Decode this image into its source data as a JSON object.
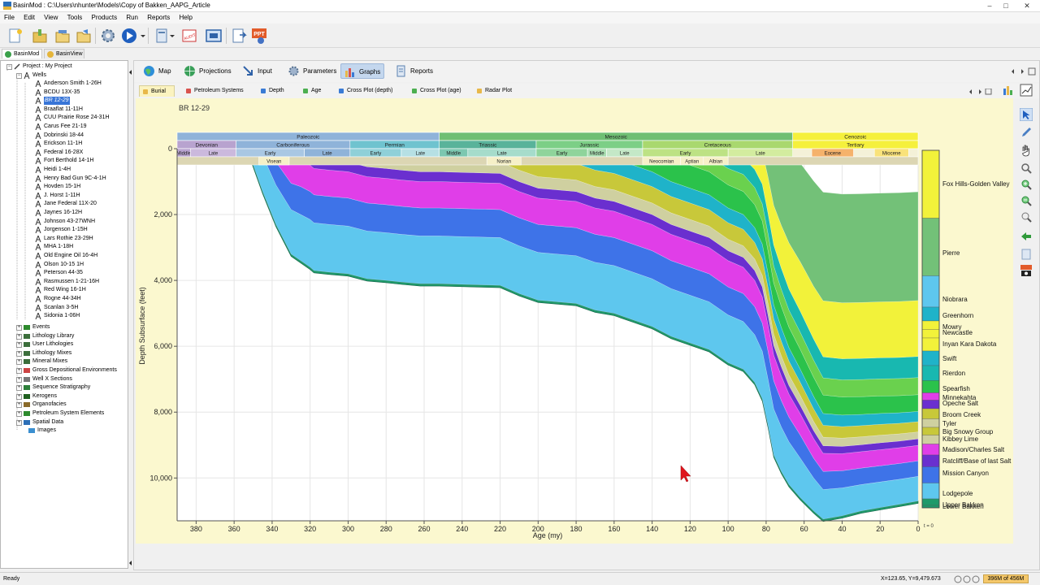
{
  "window": {
    "title": "BasinMod : C:\\Users\\nhunter\\Models\\Copy of Bakken_AAPG_Article",
    "controls": [
      "–",
      "□",
      "✕"
    ]
  },
  "menu": [
    "File",
    "Edit",
    "View",
    "Tools",
    "Products",
    "Run",
    "Reports",
    "Help"
  ],
  "toolbar": {
    "icons": [
      "new-document-icon",
      "open-folder-icon",
      "open-icon",
      "save-icon",
      "settings-gear-icon",
      "run-play-icon",
      "documents-icon",
      "audit-icon",
      "fit-window-icon",
      "export-icon",
      "ppt-export-icon"
    ],
    "audit_label": "AUDIT",
    "ppt_label": "PPT"
  },
  "view_tabs": [
    {
      "label": "BasinMod",
      "active": true
    },
    {
      "label": "BasinView",
      "active": false
    }
  ],
  "tree": {
    "project": "Project : My Project",
    "wells_label": "Wells",
    "wells": [
      "Anderson Smith 1-26H",
      "BCDU 13X-35",
      "BR 12-29",
      "Braaflat 11-11H",
      "CUU Prairie Rose 24-31H",
      "Carus Fee 21-19",
      "Dobrinski 18-44",
      "Erickson 11-1H",
      "Federal 16-28X",
      "Fort Berthold 14-1H",
      "Heidi 1-4H",
      "Henry Bad Gun 9C-4-1H",
      "Hovden 15-1H",
      "J. Horst 1-11H",
      "Jane Federal 11X-20",
      "Jaynes 16-12H",
      "Johnson 43-27WNH",
      "Jorgenson 1-15H",
      "Lars Rothie 23-29H",
      "MHA 1-18H",
      "Old Engine Oil 16-4H",
      "Olson 10-15 1H",
      "Peterson 44-35",
      "Rasmussen 1-21-16H",
      "Red Wing 16-1H",
      "Rogne 44-34H",
      "Scanlan 3-5H",
      "Sidonia 1-06H"
    ],
    "selected_well": "BR 12-29",
    "groups": [
      "Events",
      "Lithology Library",
      "User Lithologies",
      "Lithology Mixes",
      "Mineral Mixes",
      "Gross Depositional Environments",
      "Well X Sections",
      "Sequence Stratigraphy",
      "Kerogens",
      "Organofacies",
      "Petroleum System Elements",
      "Spatial Data",
      "Images"
    ]
  },
  "top_tabs": [
    {
      "label": "Map",
      "active": false
    },
    {
      "label": "Projections",
      "active": false
    },
    {
      "label": "Input",
      "active": false
    },
    {
      "label": "Parameters",
      "active": false
    },
    {
      "label": "Graphs",
      "active": true
    },
    {
      "label": "Reports",
      "active": false
    }
  ],
  "sub_tabs": [
    {
      "label": "Burial",
      "color": "#e8b84a",
      "active": true
    },
    {
      "label": "Petroleum Systems",
      "color": "#d9534f",
      "active": false
    },
    {
      "label": "Depth",
      "color": "#3a7bd5",
      "active": false
    },
    {
      "label": "Age",
      "color": "#4caf50",
      "active": false
    },
    {
      "label": "Cross Plot (depth)",
      "color": "#3a7bd5",
      "active": false
    },
    {
      "label": "Cross Plot (age)",
      "color": "#4caf50",
      "active": false
    },
    {
      "label": "Radar Plot",
      "color": "#e8b84a",
      "active": false
    }
  ],
  "chart_data": {
    "type": "area",
    "title": "BR 12-29",
    "xlabel": "Age (my)",
    "ylabel": "Depth Subsurface (feet)",
    "xlim": [
      390,
      0
    ],
    "ylim": [
      0,
      11300
    ],
    "x_ticks": [
      380,
      360,
      340,
      320,
      300,
      280,
      260,
      240,
      220,
      200,
      180,
      160,
      140,
      120,
      100,
      80,
      60,
      40,
      20,
      0
    ],
    "y_ticks": [
      0,
      2000,
      4000,
      6000,
      8000,
      10000
    ],
    "y_tick_labels": [
      "0",
      "2,000",
      "4,000",
      "6,000",
      "8,000",
      "10,000"
    ],
    "grid": true,
    "eras": [
      {
        "name": "Paleozoic",
        "from": 390,
        "to": 252,
        "color": "#8fb3d9"
      },
      {
        "name": "Mesozoic",
        "from": 252,
        "to": 66,
        "color": "#6fbf73"
      },
      {
        "name": "Cenozoic",
        "from": 66,
        "to": 0,
        "color": "#f5f03c"
      }
    ],
    "periods": [
      {
        "name": "Devonian",
        "from": 390,
        "to": 359,
        "color": "#b8a3cf"
      },
      {
        "name": "Carboniferous",
        "from": 359,
        "to": 299,
        "color": "#8fb3d9"
      },
      {
        "name": "Permian",
        "from": 299,
        "to": 252,
        "color": "#6fc3cf"
      },
      {
        "name": "Triassic",
        "from": 252,
        "to": 201,
        "color": "#59b39a"
      },
      {
        "name": "Jurassic",
        "from": 201,
        "to": 145,
        "color": "#7ccf86"
      },
      {
        "name": "Cretaceous",
        "from": 145,
        "to": 66,
        "color": "#a9d86e"
      },
      {
        "name": "Tertiary",
        "from": 66,
        "to": 0,
        "color": "#f5f03c"
      }
    ],
    "epochs": [
      {
        "name": "Middle",
        "from": 390,
        "to": 383,
        "color": "#b8a3cf"
      },
      {
        "name": "Late",
        "from": 383,
        "to": 359,
        "color": "#cbb9dd"
      },
      {
        "name": "Early",
        "from": 359,
        "to": 323,
        "color": "#a9c7e3"
      },
      {
        "name": "Late",
        "from": 323,
        "to": 299,
        "color": "#8fb3d9"
      },
      {
        "name": "Early",
        "from": 299,
        "to": 272,
        "color": "#8fd0d8"
      },
      {
        "name": "Late",
        "from": 272,
        "to": 252,
        "color": "#b6e0e4"
      },
      {
        "name": "Middle",
        "from": 252,
        "to": 237,
        "color": "#7cc7b0"
      },
      {
        "name": "Late",
        "from": 237,
        "to": 201,
        "color": "#a6dccb"
      },
      {
        "name": "Early",
        "from": 201,
        "to": 174,
        "color": "#8fd49b"
      },
      {
        "name": "Middle",
        "from": 174,
        "to": 164,
        "color": "#a8ddb1"
      },
      {
        "name": "Late",
        "from": 164,
        "to": 145,
        "color": "#c4e8c7"
      },
      {
        "name": "Early",
        "from": 145,
        "to": 100,
        "color": "#bde284"
      },
      {
        "name": "Late",
        "from": 100,
        "to": 66,
        "color": "#d3ec9f"
      },
      {
        "name": "Eocene",
        "from": 56,
        "to": 34,
        "color": "#f5b26b"
      },
      {
        "name": "Miocene",
        "from": 23,
        "to": 5,
        "color": "#f9e27a"
      }
    ],
    "stages": [
      {
        "name": "Visean",
        "from": 347,
        "to": 331
      },
      {
        "name": "Norian",
        "from": 227,
        "to": 209
      },
      {
        "name": "Neocomian",
        "from": 145,
        "to": 125
      },
      {
        "name": "Aptian",
        "from": 125,
        "to": 113
      },
      {
        "name": "Albian",
        "from": 113,
        "to": 100
      }
    ],
    "basement": {
      "ages": [
        390,
        353,
        345,
        338,
        330,
        325,
        320,
        318,
        310,
        300,
        290,
        280,
        272,
        262,
        252,
        240,
        220,
        210,
        200,
        190,
        180,
        170,
        160,
        150,
        140,
        130,
        120,
        110,
        100,
        92,
        86,
        82,
        79,
        76,
        72,
        68,
        62,
        55,
        50,
        40,
        30,
        20,
        10,
        0
      ],
      "depths": [
        0,
        0,
        1300,
        2300,
        3200,
        3400,
        3600,
        3700,
        3750,
        3800,
        3950,
        4000,
        4050,
        4100,
        4100,
        4120,
        4150,
        4400,
        4600,
        4650,
        4700,
        4900,
        5000,
        5200,
        5400,
        5700,
        5900,
        6100,
        6500,
        6700,
        7100,
        7600,
        8400,
        9300,
        9800,
        10200,
        10600,
        11000,
        11250,
        11150,
        11000,
        10900,
        10800,
        10700
      ]
    },
    "layers": [
      {
        "color": "#5ec7ee",
        "base_age": 353,
        "thickness": [
          0,
          0,
          1100,
          1200,
          1350,
          1400,
          1450,
          1450,
          1450,
          1450,
          1450,
          1450,
          1450,
          1450,
          1450,
          1450,
          1450,
          1450,
          1450,
          1450,
          1450,
          1450,
          1450,
          1450,
          1450,
          1450,
          1450,
          1450,
          1450,
          1450,
          1450,
          1450,
          1400,
          1400,
          1350,
          1300,
          1200,
          1000,
          900,
          850,
          800,
          780,
          760,
          750
        ]
      },
      {
        "color": "#3e73e8",
        "base_age": 345,
        "thickness": [
          0,
          0,
          0,
          700,
          800,
          850,
          850,
          850,
          850,
          850,
          850,
          850,
          850,
          850,
          850,
          850,
          850,
          850,
          850,
          850,
          850,
          850,
          850,
          850,
          850,
          850,
          850,
          850,
          850,
          850,
          850,
          850,
          850,
          850,
          800,
          750,
          700,
          600,
          550,
          520,
          500,
          490,
          480,
          470
        ]
      },
      {
        "color": "#e03ee8",
        "base_age": 330,
        "thickness": [
          0,
          0,
          0,
          0,
          700,
          800,
          800,
          800,
          800,
          800,
          800,
          800,
          800,
          800,
          800,
          800,
          800,
          800,
          800,
          800,
          800,
          800,
          800,
          800,
          800,
          800,
          800,
          800,
          800,
          800,
          800,
          800,
          800,
          780,
          750,
          700,
          650,
          600,
          550,
          520,
          500,
          490,
          480,
          470
        ]
      },
      {
        "color": "#6a2fcf",
        "base_age": 325,
        "thickness": [
          0,
          0,
          0,
          0,
          0,
          300,
          300,
          300,
          300,
          300,
          300,
          300,
          300,
          300,
          300,
          300,
          300,
          300,
          300,
          300,
          300,
          300,
          300,
          300,
          300,
          300,
          300,
          300,
          300,
          300,
          300,
          300,
          300,
          300,
          280,
          260,
          250,
          240,
          230,
          220,
          210,
          210,
          200,
          200
        ]
      },
      {
        "color": "#cfd0a0",
        "base_age": 318,
        "thickness": [
          0,
          0,
          0,
          0,
          0,
          0,
          0,
          300,
          350,
          350,
          350,
          350,
          350,
          350,
          350,
          350,
          350,
          350,
          350,
          350,
          350,
          350,
          350,
          350,
          350,
          350,
          350,
          350,
          350,
          350,
          350,
          350,
          350,
          340,
          330,
          320,
          300,
          280,
          260,
          250,
          240,
          230,
          220,
          210
        ]
      },
      {
        "color": "#c8c83a",
        "base_age": 300,
        "thickness": [
          0,
          0,
          0,
          0,
          0,
          0,
          0,
          0,
          0,
          350,
          450,
          500,
          500,
          500,
          500,
          500,
          500,
          500,
          500,
          500,
          500,
          500,
          500,
          500,
          500,
          500,
          500,
          500,
          500,
          500,
          500,
          500,
          480,
          460,
          440,
          420,
          400,
          380,
          360,
          350,
          340,
          330,
          320,
          310
        ]
      },
      {
        "color": "#1fb3c9",
        "base_age": 240,
        "thickness": [
          0,
          0,
          0,
          0,
          0,
          0,
          0,
          0,
          0,
          0,
          0,
          0,
          0,
          0,
          0,
          250,
          400,
          450,
          450,
          450,
          450,
          450,
          450,
          450,
          450,
          450,
          450,
          450,
          450,
          450,
          450,
          450,
          440,
          430,
          420,
          410,
          400,
          380,
          360,
          350,
          340,
          330,
          320,
          310
        ]
      },
      {
        "color": "#2bc24b",
        "base_age": 190,
        "thickness": [
          0,
          0,
          0,
          0,
          0,
          0,
          0,
          0,
          0,
          0,
          0,
          0,
          0,
          0,
          0,
          0,
          0,
          0,
          0,
          200,
          350,
          500,
          600,
          700,
          700,
          700,
          700,
          700,
          700,
          700,
          700,
          700,
          680,
          660,
          640,
          620,
          600,
          580,
          560,
          550,
          540,
          530,
          520,
          510
        ]
      },
      {
        "color": "#6ad14e",
        "base_age": 140,
        "thickness": [
          0,
          0,
          0,
          0,
          0,
          0,
          0,
          0,
          0,
          0,
          0,
          0,
          0,
          0,
          0,
          0,
          0,
          0,
          0,
          0,
          0,
          0,
          0,
          0,
          200,
          300,
          400,
          450,
          500,
          520,
          520,
          520,
          520,
          520,
          520,
          520,
          520,
          520,
          520,
          520,
          520,
          520,
          520,
          520
        ]
      },
      {
        "color": "#18b8b0",
        "base_age": 110,
        "thickness": [
          0,
          0,
          0,
          0,
          0,
          0,
          0,
          0,
          0,
          0,
          0,
          0,
          0,
          0,
          0,
          0,
          0,
          0,
          0,
          0,
          0,
          0,
          0,
          0,
          0,
          0,
          0,
          300,
          400,
          500,
          550,
          600,
          620,
          640,
          640,
          640,
          640,
          640,
          640,
          640,
          640,
          640,
          640,
          640
        ]
      },
      {
        "color": "#f2f23a",
        "base_age": 92,
        "thickness": [
          0,
          0,
          0,
          0,
          0,
          0,
          0,
          0,
          0,
          0,
          0,
          0,
          0,
          0,
          0,
          0,
          0,
          0,
          0,
          0,
          0,
          0,
          0,
          0,
          0,
          0,
          0,
          0,
          0,
          500,
          800,
          1000,
          1100,
          1200,
          1300,
          1400,
          1500,
          1600,
          1700,
          1700,
          1700,
          1700,
          1700,
          1700
        ]
      },
      {
        "color": "#73c178",
        "base_age": 79,
        "thickness": [
          0,
          0,
          0,
          0,
          0,
          0,
          0,
          0,
          0,
          0,
          0,
          0,
          0,
          0,
          0,
          0,
          0,
          0,
          0,
          0,
          0,
          0,
          0,
          0,
          0,
          0,
          0,
          0,
          0,
          0,
          0,
          0,
          600,
          1400,
          2000,
          2500,
          3000,
          3200,
          3300,
          3300,
          3300,
          3300,
          3300,
          3300
        ]
      }
    ],
    "legend": [
      "Fox Hills-Golden Valley",
      "Pierre",
      "Niobrara",
      "Greenhorn",
      "Mowry",
      "Newcastle",
      "Inyan Kara Dakota",
      "Swift",
      "Rierdon",
      "Spearfish",
      "Minnekahta",
      "Opeche Salt",
      "Broom Creek",
      "Tyler",
      "Big Snowy Group",
      "Kibbey Lime",
      "Madison/Charles Salt",
      "Ratcliff/Base of last Salt",
      "Mission Canyon",
      "Lodgepole",
      "Upper Bakken",
      "Lower Bakken"
    ],
    "legend_bottom_label": "t = 0"
  },
  "status": {
    "ready": "Ready",
    "coords": "X=123.65, Y=9,479.673",
    "memory": "396M of 456M"
  }
}
